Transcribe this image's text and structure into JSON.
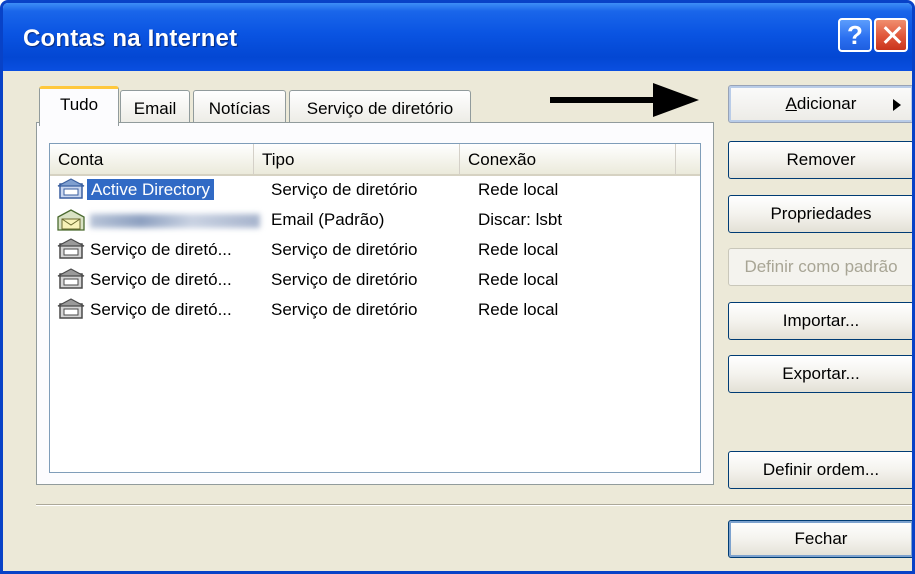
{
  "window": {
    "title": "Contas na Internet"
  },
  "titlebar": {
    "help_label": "?"
  },
  "tabs": [
    {
      "label": "Tudo",
      "active": true
    },
    {
      "label": "Email"
    },
    {
      "label": "Notícias"
    },
    {
      "label": "Serviço de diretório"
    }
  ],
  "list": {
    "columns": [
      "Conta",
      "Tipo",
      "Conexão"
    ],
    "rows": [
      {
        "conta": "Active Directory",
        "tipo": "Serviço de diretório",
        "conexao": "Rede local",
        "icon": "directory-service-icon",
        "selected": true
      },
      {
        "conta": "",
        "tipo": "Email (Padrão)",
        "conexao": "Discar: lsbt",
        "icon": "mail-account-icon",
        "blurred": true
      },
      {
        "conta": "Serviço de diretó...",
        "tipo": "Serviço de diretório",
        "conexao": "Rede local",
        "icon": "directory-service-icon"
      },
      {
        "conta": "Serviço de diretó...",
        "tipo": "Serviço de diretório",
        "conexao": "Rede local",
        "icon": "directory-service-icon"
      },
      {
        "conta": "Serviço de diretó...",
        "tipo": "Serviço de diretório",
        "conexao": "Rede local",
        "icon": "directory-service-icon"
      }
    ]
  },
  "buttons": {
    "adicionar_first": "A",
    "adicionar_rest": "dicionar",
    "remover": "Remover",
    "propriedades": "Propriedades",
    "definir_padrao": "Definir como padrão",
    "importar": "Importar...",
    "exportar": "Exportar...",
    "definir_ordem": "Definir ordem...",
    "fechar": "Fechar"
  },
  "colors": {
    "title_bar": "#0a54e2",
    "selection": "#316ac5",
    "dialog_bg": "#ece9d8"
  }
}
